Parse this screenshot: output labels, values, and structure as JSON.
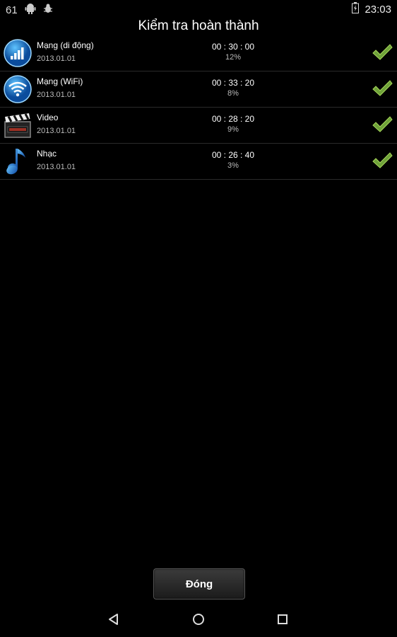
{
  "status_bar": {
    "left_number": "61",
    "time": "23:03",
    "icons": [
      "android-icon",
      "bug-icon",
      "battery-icon"
    ]
  },
  "title": "Kiểm tra hoàn thành",
  "rows": [
    {
      "icon": "signal-bars-icon",
      "name": "Mạng (di động)",
      "date": "2013.01.01",
      "duration": "00 : 30 : 00",
      "percent": "12%"
    },
    {
      "icon": "wifi-icon",
      "name": "Mạng (WiFi)",
      "date": "2013.01.01",
      "duration": "00 : 33 : 20",
      "percent": "8%"
    },
    {
      "icon": "clapperboard-icon",
      "name": "Video",
      "date": "2013.01.01",
      "duration": "00 : 28 : 20",
      "percent": "9%"
    },
    {
      "icon": "music-note-icon",
      "name": "Nhạc",
      "date": "2013.01.01",
      "duration": "00 : 26 : 40",
      "percent": "3%"
    }
  ],
  "close_button": {
    "label": "Đóng"
  },
  "navigation": {
    "icons": [
      "back-icon",
      "home-icon",
      "recents-icon"
    ]
  },
  "colors": {
    "background": "#000000",
    "check": "#6fa23a",
    "icon_blue": "#1e88e5"
  }
}
